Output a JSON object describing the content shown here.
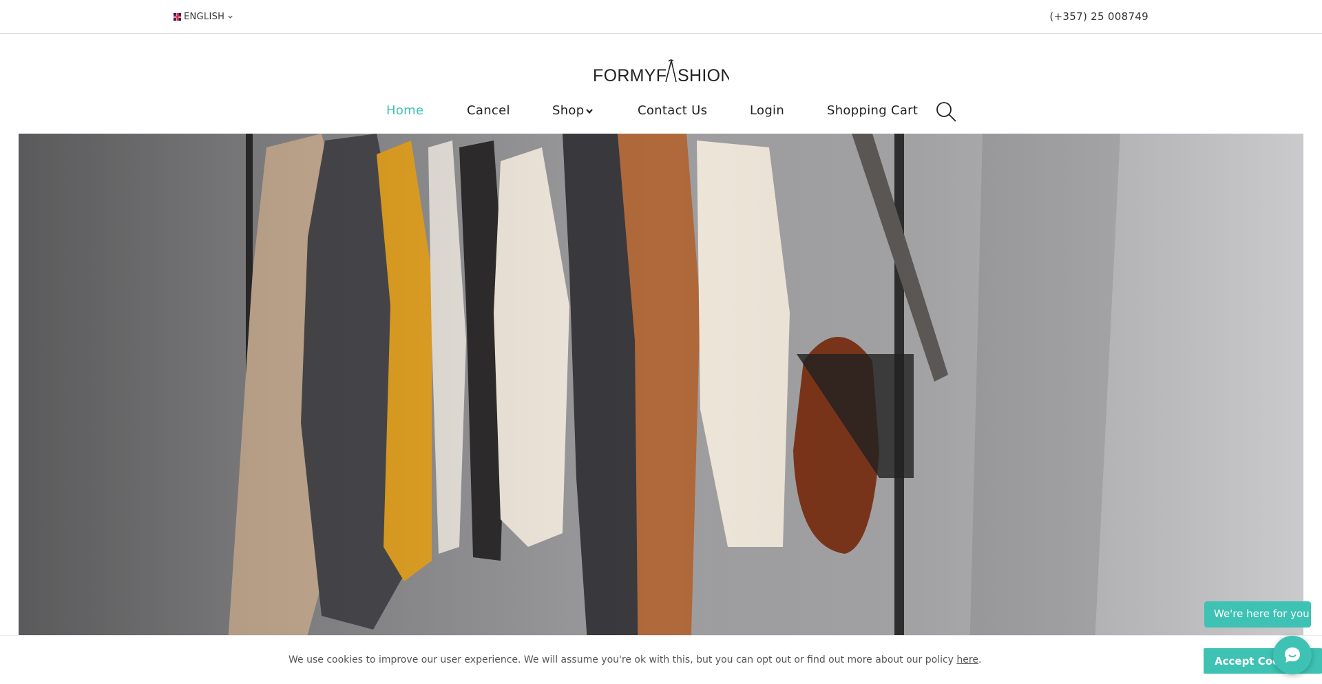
{
  "topbar": {
    "language": "ENGLISH",
    "phone": "(+357) 25 008749"
  },
  "logo": {
    "text_left": "FORMYF",
    "text_right": "SHION"
  },
  "nav": {
    "items": [
      {
        "label": "Home",
        "active": true
      },
      {
        "label": "Cancel"
      },
      {
        "label": "Shop",
        "has_dropdown": true
      },
      {
        "label": "Contact Us"
      },
      {
        "label": "Login"
      },
      {
        "label": "Shopping Cart"
      }
    ],
    "search_icon": "search-icon"
  },
  "cookie": {
    "text": "We use cookies to improve our user experience. We will assume you're ok with this, but you can opt out or find out more about our policy ",
    "link": "here",
    "end": ".",
    "accept_label": "Accept Cookies"
  },
  "chat": {
    "label": "We're here for you",
    "icon": "chat-icon"
  },
  "colors": {
    "accent": "#3ec2b3",
    "text": "#222222"
  }
}
